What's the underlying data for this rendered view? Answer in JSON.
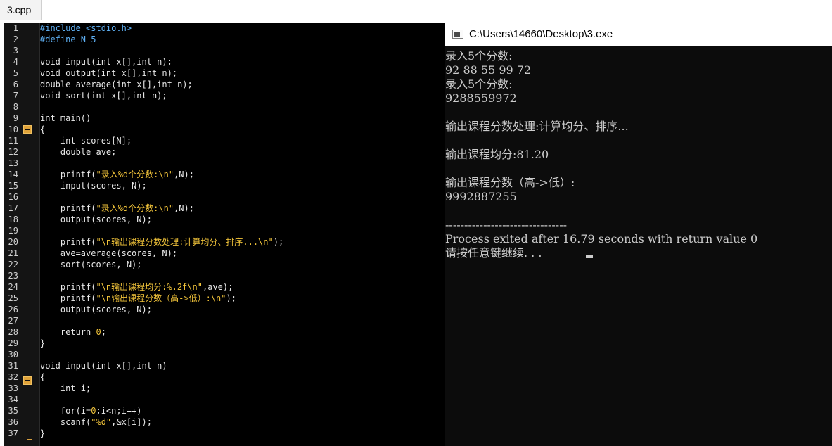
{
  "tab": {
    "label": "3.cpp"
  },
  "editor": {
    "lines": [
      [
        {
          "t": "pp",
          "v": "#include <stdio.h>"
        }
      ],
      [
        {
          "t": "pp",
          "v": "#define N 5"
        }
      ],
      [],
      [
        {
          "t": "kw",
          "v": "void "
        },
        {
          "t": "id",
          "v": "input(int x[],int n);"
        }
      ],
      [
        {
          "t": "kw",
          "v": "void "
        },
        {
          "t": "id",
          "v": "output(int x[],int n);"
        }
      ],
      [
        {
          "t": "kw",
          "v": "double "
        },
        {
          "t": "id",
          "v": "average(int x[],int n);"
        }
      ],
      [
        {
          "t": "kw",
          "v": "void "
        },
        {
          "t": "id",
          "v": "sort(int x[],int n);"
        }
      ],
      [],
      [
        {
          "t": "kw",
          "v": "int "
        },
        {
          "t": "id",
          "v": "main()"
        }
      ],
      [
        {
          "t": "id",
          "v": "{"
        }
      ],
      [
        {
          "t": "id",
          "v": "    int scores[N];"
        }
      ],
      [
        {
          "t": "id",
          "v": "    double ave;"
        }
      ],
      [],
      [
        {
          "t": "id",
          "v": "    printf("
        },
        {
          "t": "str",
          "v": "\"录入%d个分数:\\n\""
        },
        {
          "t": "id",
          "v": ",N);"
        }
      ],
      [
        {
          "t": "id",
          "v": "    input(scores, N);"
        }
      ],
      [],
      [
        {
          "t": "id",
          "v": "    printf("
        },
        {
          "t": "str",
          "v": "\"录入%d个分数:\\n\""
        },
        {
          "t": "id",
          "v": ",N);"
        }
      ],
      [
        {
          "t": "id",
          "v": "    output(scores, N);"
        }
      ],
      [],
      [
        {
          "t": "id",
          "v": "    printf("
        },
        {
          "t": "str",
          "v": "\"\\n输出课程分数处理:计算均分、排序...\\n\""
        },
        {
          "t": "id",
          "v": ");"
        }
      ],
      [
        {
          "t": "id",
          "v": "    ave=average(scores, N);"
        }
      ],
      [
        {
          "t": "id",
          "v": "    sort(scores, N);"
        }
      ],
      [],
      [
        {
          "t": "id",
          "v": "    printf("
        },
        {
          "t": "str",
          "v": "\"\\n输出课程均分:%.2f\\n\""
        },
        {
          "t": "id",
          "v": ",ave);"
        }
      ],
      [
        {
          "t": "id",
          "v": "    printf("
        },
        {
          "t": "str",
          "v": "\"\\n输出课程分数（高->低）:\\n\""
        },
        {
          "t": "id",
          "v": ");"
        }
      ],
      [
        {
          "t": "id",
          "v": "    output(scores, N);"
        }
      ],
      [],
      [
        {
          "t": "id",
          "v": "    return "
        },
        {
          "t": "str",
          "v": "0"
        },
        {
          "t": "id",
          "v": ";"
        }
      ],
      [
        {
          "t": "id",
          "v": "}"
        }
      ],
      [],
      [
        {
          "t": "kw",
          "v": "void "
        },
        {
          "t": "id",
          "v": "input(int x[],int n)"
        }
      ],
      [
        {
          "t": "id",
          "v": "{"
        }
      ],
      [
        {
          "t": "id",
          "v": "    int i;"
        }
      ],
      [],
      [
        {
          "t": "id",
          "v": "    for(i="
        },
        {
          "t": "str",
          "v": "0"
        },
        {
          "t": "id",
          "v": ";i<n;i++)"
        }
      ],
      [
        {
          "t": "id",
          "v": "    scanf("
        },
        {
          "t": "str",
          "v": "\"%d\""
        },
        {
          "t": "id",
          "v": ",&x[i]);"
        }
      ],
      [
        {
          "t": "id",
          "v": "}"
        }
      ]
    ]
  },
  "console": {
    "title": "C:\\Users\\14660\\Desktop\\3.exe",
    "lines": [
      "录入5个分数:",
      "92 88 55 99 72",
      "录入5个分数:",
      "9288559972",
      "",
      "输出课程分数处理:计算均分、排序...",
      "",
      "输出课程均分:81.20",
      "",
      "输出课程分数（高->低）:",
      "9992887255",
      "",
      "--------------------------------",
      "Process exited after 16.79 seconds with return value 0",
      "请按任意键继续. . ."
    ]
  }
}
